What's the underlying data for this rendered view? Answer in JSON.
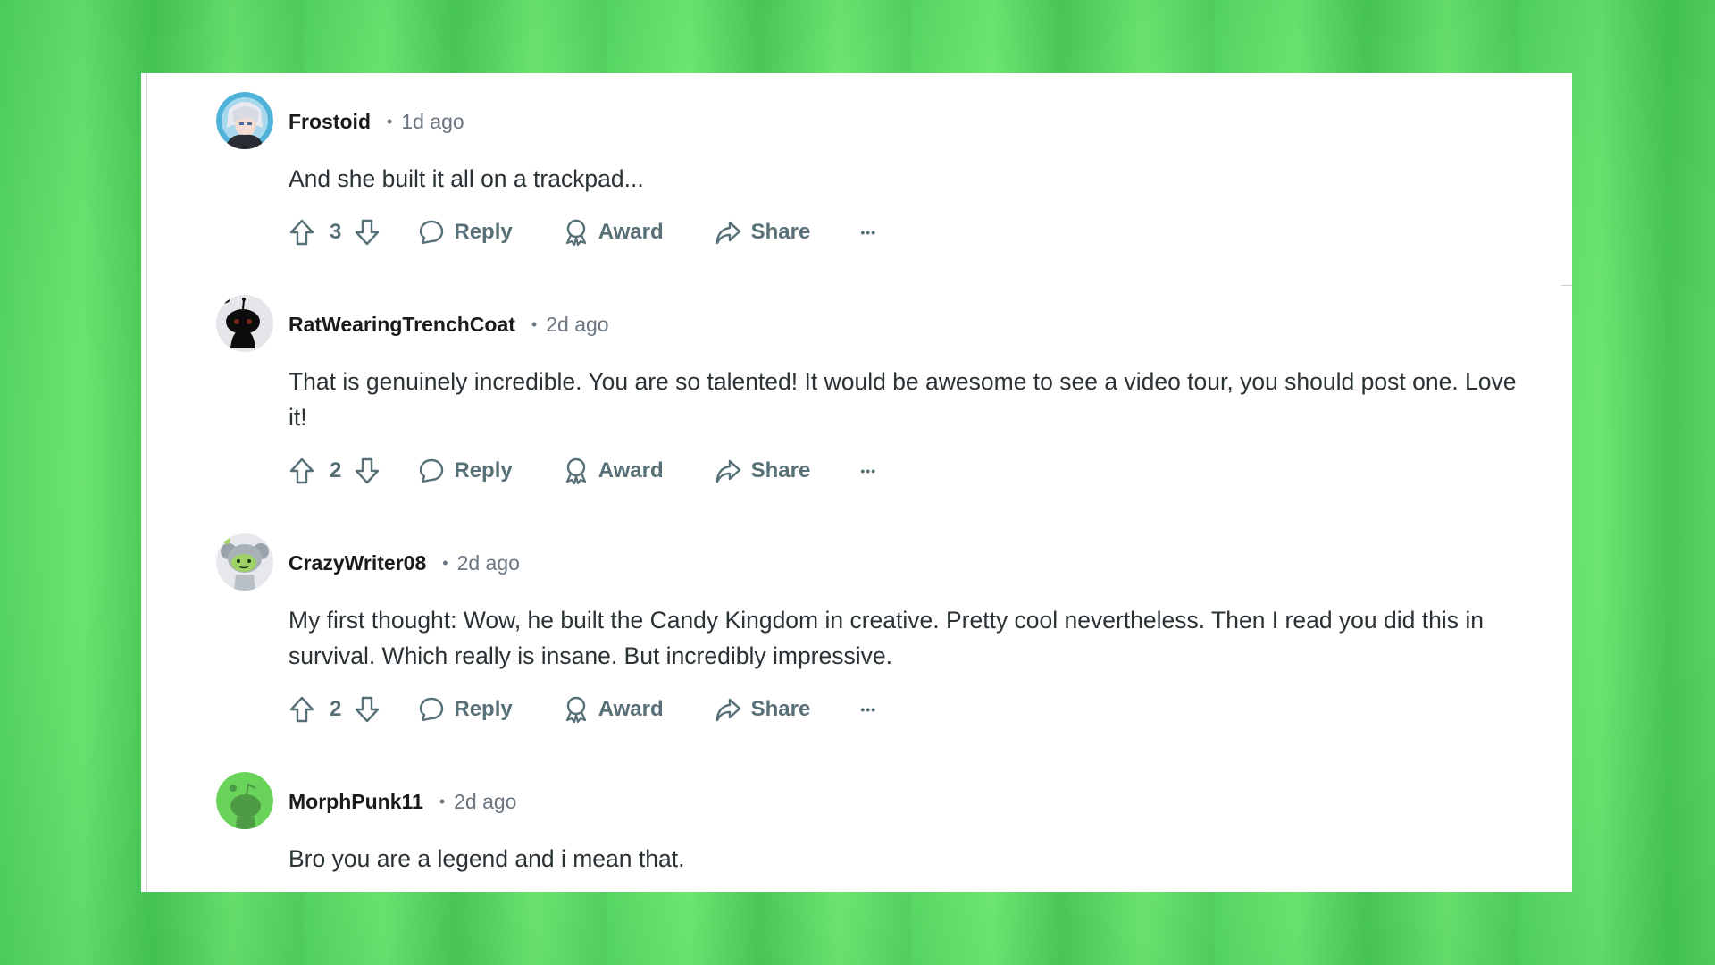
{
  "comments": [
    {
      "username": "Frostoid",
      "separator": "•",
      "time": "1d ago",
      "avatar": "anime-character-avatar",
      "body": "And she built it all on a trackpad...",
      "votes": "3",
      "actions": {
        "reply": "Reply",
        "award": "Award",
        "share": "Share",
        "more": "•••"
      }
    },
    {
      "username": "RatWearingTrenchCoat",
      "separator": "•",
      "time": "2d ago",
      "avatar": "black-snoo-avatar",
      "body": "That is genuinely incredible. You are so talented! It would be awesome to see a video tour, you should post one. Love it!",
      "votes": "2",
      "actions": {
        "reply": "Reply",
        "award": "Award",
        "share": "Share",
        "more": "•••"
      }
    },
    {
      "username": "CrazyWriter08",
      "separator": "•",
      "time": "2d ago",
      "avatar": "koala-snoo-avatar",
      "body": "My first thought: Wow, he built the Candy Kingdom in creative. Pretty cool nevertheless. Then I read you did this in survival. Which really is insane. But incredibly impressive.",
      "votes": "2",
      "actions": {
        "reply": "Reply",
        "award": "Award",
        "share": "Share",
        "more": "•••"
      }
    },
    {
      "username": "MorphPunk11",
      "separator": "•",
      "time": "2d ago",
      "avatar": "default-green-snoo-avatar",
      "body": "Bro you are a legend and i mean that."
    }
  ],
  "colors": {
    "background_green": "#6be275",
    "text_primary": "#1a1a1b",
    "text_meta": "#6b7680",
    "action_gray": "#576f76",
    "avatar_green": "#6ad45a"
  }
}
